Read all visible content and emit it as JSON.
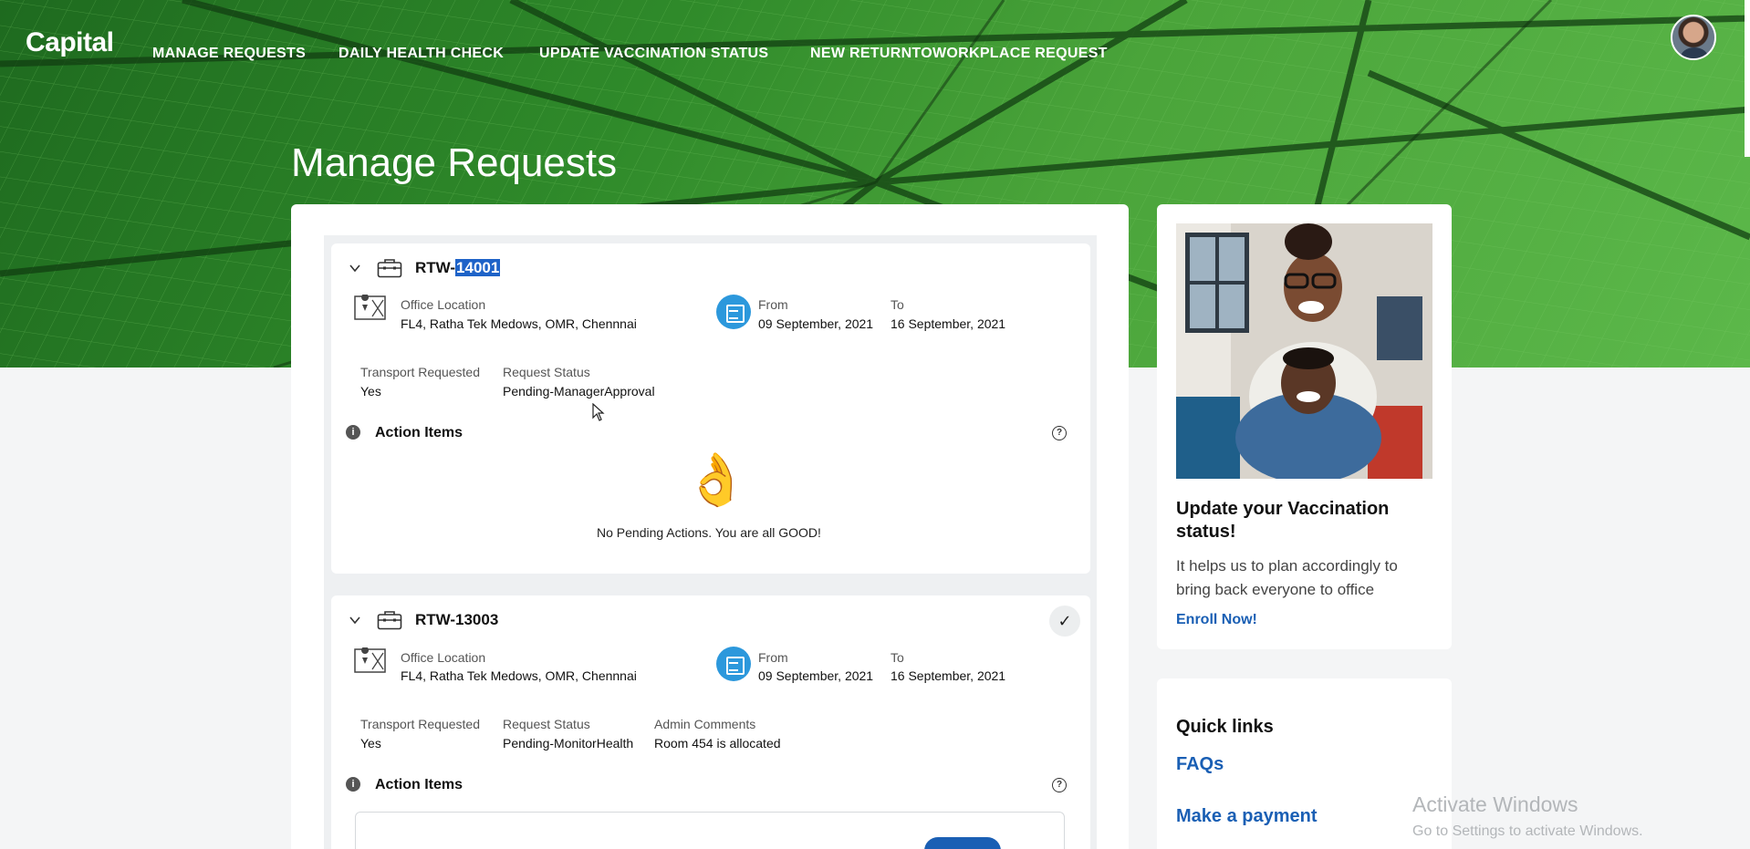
{
  "nav": {
    "logo": "Capital",
    "links": [
      "MANAGE REQUESTS",
      "DAILY HEALTH CHECK",
      "UPDATE VACCINATION STATUS",
      "NEW RETURNTOWORKPLACE REQUEST"
    ]
  },
  "page": {
    "title": "Manage Requests"
  },
  "requests": [
    {
      "id_prefix": "RTW-",
      "id_number": "14001",
      "office_location_label": "Office Location",
      "office_location": "FL4, Ratha Tek Medows, OMR, Chennnai",
      "from_label": "From",
      "from": "09 September, 2021",
      "to_label": "To",
      "to": "16 September, 2021",
      "transport_label": "Transport Requested",
      "transport": "Yes",
      "status_label": "Request Status",
      "status": "Pending-ManagerApproval",
      "action_items_label": "Action Items",
      "no_pending": "No Pending Actions. You are all GOOD!",
      "emoji": "👌"
    },
    {
      "id": "RTW-13003",
      "office_location_label": "Office Location",
      "office_location": "FL4, Ratha Tek Medows, OMR, Chennnai",
      "from_label": "From",
      "from": "09 September, 2021",
      "to_label": "To",
      "to": "16 September, 2021",
      "transport_label": "Transport Requested",
      "transport": "Yes",
      "status_label": "Request Status",
      "status": "Pending-MonitorHealth",
      "admin_label": "Admin Comments",
      "admin_comments": "Room 454 is allocated",
      "action_items_label": "Action Items",
      "check_glyph": "✓"
    }
  ],
  "vaccination_card": {
    "heading": "Update your Vaccination status!",
    "text": "It helps us to plan accordingly to bring back everyone to office",
    "link": "Enroll Now!"
  },
  "quick_links": {
    "title": "Quick links",
    "links": [
      "FAQs",
      "Make a payment"
    ]
  },
  "watermark": {
    "line1": "Activate Windows",
    "line2": "Go to Settings to activate Windows."
  },
  "icons": {
    "info": "i",
    "help": "?"
  },
  "colors": {
    "brand_green": "#2f8a2a",
    "link_blue": "#1a5fb4",
    "calendar_blue": "#2c98dc",
    "highlight": "#1e63c8"
  }
}
